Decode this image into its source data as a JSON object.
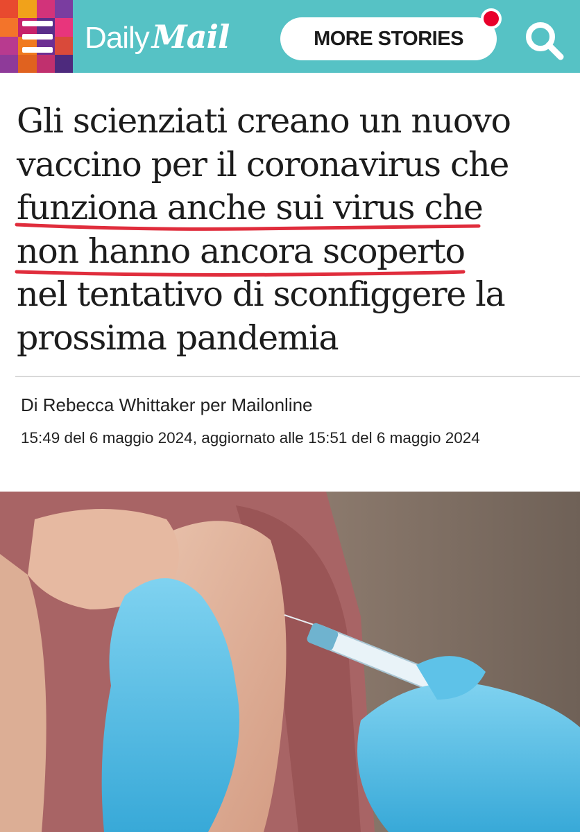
{
  "header": {
    "logo_daily": "Daily",
    "logo_mail": "Mail",
    "more_stories_label": "MORE STORIES",
    "colors": {
      "header_bg": "#56c2c5",
      "notification_dot": "#e8002a",
      "mosaic": [
        "#e84a2f",
        "#f1a21a",
        "#d2337a",
        "#7a3da0",
        "#f3742a",
        "#c7226b",
        "#5a2e8a",
        "#e8357c",
        "#b83a8f",
        "#f07a1f",
        "#6d2f92",
        "#d94a3a",
        "#8e3a99",
        "#e0621f",
        "#c0306e",
        "#4d2a7d"
      ]
    },
    "icons": [
      "menu-icon",
      "search-icon"
    ]
  },
  "article": {
    "headline_lines": [
      "Gli scienziati creano un nuovo",
      "vaccino per il coronavirus che",
      "funziona anche sui virus che",
      "non hanno ancora scoperto",
      "nel tentativo di sconfiggere la",
      "prossima pandemia"
    ],
    "underline_color": "#e02d3c",
    "byline": "Di Rebecca Whittaker per Mailonline",
    "timestamp": "15:49 del 6 maggio 2024, aggiornato alle 15:51 del 6 maggio 2024"
  }
}
